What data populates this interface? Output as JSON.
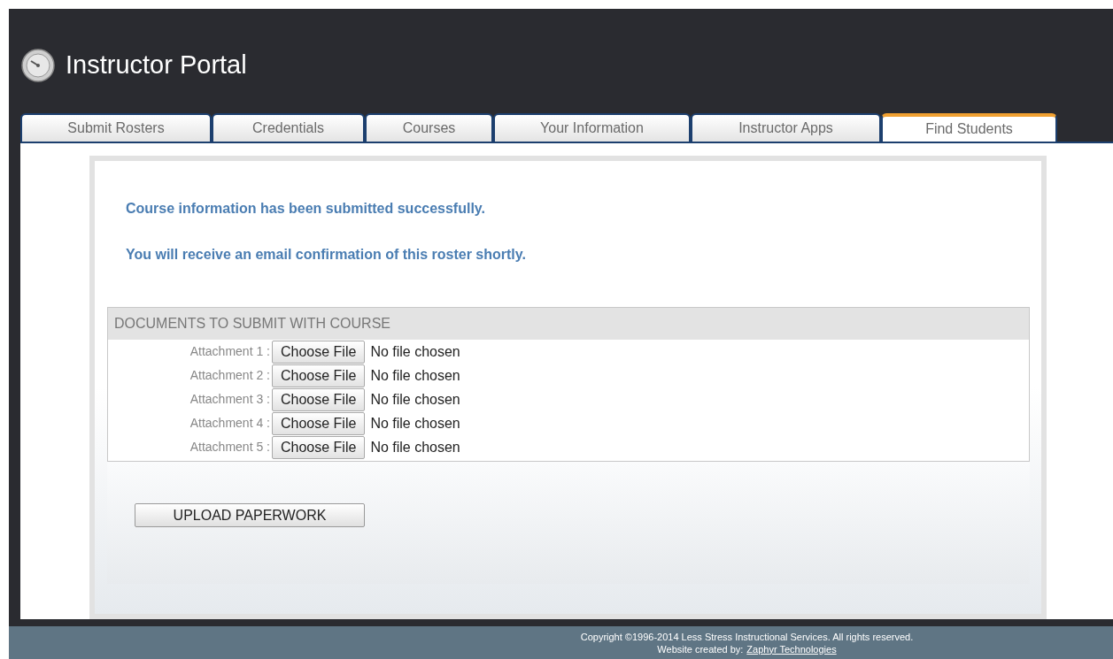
{
  "header": {
    "title": "Instructor Portal"
  },
  "tabs": [
    {
      "label": "Submit Rosters",
      "selected": false
    },
    {
      "label": "Credentials",
      "selected": false
    },
    {
      "label": "Courses",
      "selected": false
    },
    {
      "label": "Your Information",
      "selected": false
    },
    {
      "label": "Instructor Apps",
      "selected": false
    },
    {
      "label": "Find Students",
      "selected": true
    }
  ],
  "messages": [
    "Course information has been submitted successfully.",
    "You will receive an email confirmation of this roster shortly."
  ],
  "documents": {
    "heading": "DOCUMENTS TO SUBMIT WITH COURSE",
    "attachments": [
      {
        "label": "Attachment 1 :",
        "button": "Choose File",
        "status": "No file chosen"
      },
      {
        "label": "Attachment 2 :",
        "button": "Choose File",
        "status": "No file chosen"
      },
      {
        "label": "Attachment 3 :",
        "button": "Choose File",
        "status": "No file chosen"
      },
      {
        "label": "Attachment 4 :",
        "button": "Choose File",
        "status": "No file chosen"
      },
      {
        "label": "Attachment 5 :",
        "button": "Choose File",
        "status": "No file chosen"
      }
    ]
  },
  "upload_button": "UPLOAD PAPERWORK",
  "footer": {
    "copyright": "Copyright ©1996-2014 Less Stress Instructional Services. All rights reserved.",
    "credit": "Website created by:",
    "credit_link": "Zaphyr Technologies"
  }
}
